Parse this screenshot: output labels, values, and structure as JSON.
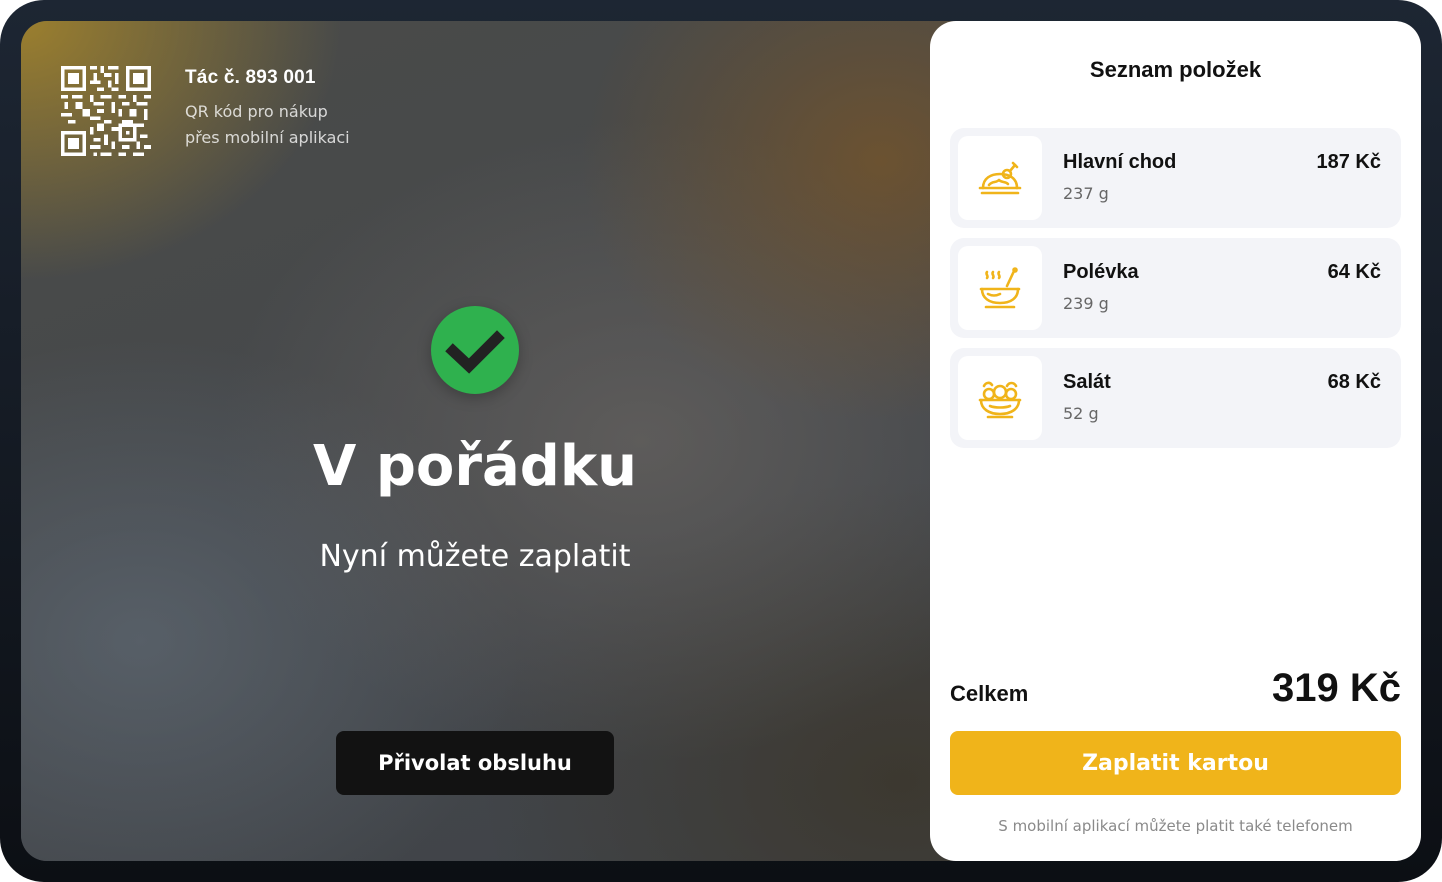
{
  "header": {
    "table_number": "Tác č. 893 001",
    "qr_description_line1": "QR kód pro nákup",
    "qr_description_line2": "přes mobilní aplikaci",
    "qr_icon": "qr-code-icon"
  },
  "status": {
    "icon": "check-circle-icon",
    "title": "V pořádku",
    "subtitle": "Nyní můžete zaplatit",
    "call_staff_label": "Přivolat obsluhu"
  },
  "panel": {
    "title": "Seznam položek",
    "items": [
      {
        "name": "Hlavní chod",
        "weight": "237 g",
        "price": "187 Kč",
        "icon": "main-course-icon"
      },
      {
        "name": "Polévka",
        "weight": "239 g",
        "price": "64 Kč",
        "icon": "soup-bowl-icon"
      },
      {
        "name": "Salát",
        "weight": "52 g",
        "price": "68 Kč",
        "icon": "salad-bowl-icon"
      }
    ],
    "total_label": "Celkem",
    "total_value": "319 Kč",
    "pay_label": "Zaplatit kartou",
    "footnote": "S mobilní aplikací můžete platit také telefonem"
  },
  "colors": {
    "accent": "#f0b41a",
    "success": "#2fb14e",
    "icon": "#f0b41a"
  }
}
